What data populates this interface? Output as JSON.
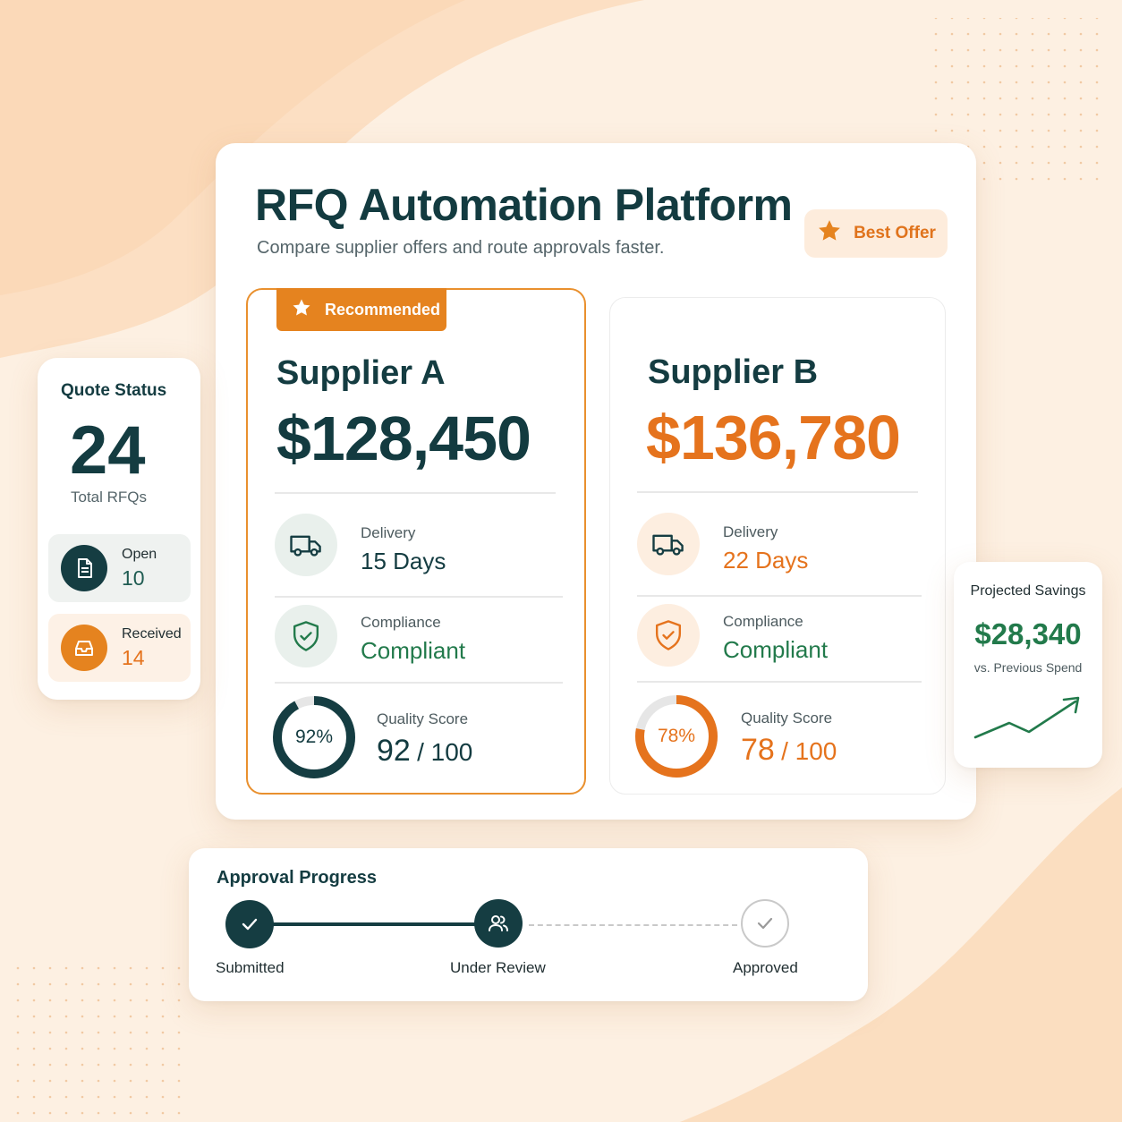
{
  "platform": {
    "title": "RFQ Automation Platform",
    "subtitle": "Compare supplier offers and route approvals faster.",
    "best_offer_label": "Best Offer"
  },
  "suppliers": [
    {
      "tag": "Recommended",
      "name": "Supplier A",
      "price": "$128,450",
      "delivery_label": "Delivery",
      "delivery_value": "15 Days",
      "compliance_label": "Compliance",
      "compliance_value": "Compliant",
      "quality_label": "Quality Score",
      "quality_percent_label": "92%",
      "quality_score": "92",
      "quality_max": "/ 100",
      "quality_fraction": 0.92,
      "accent_color": "#153d42"
    },
    {
      "name": "Supplier B",
      "price": "$136,780",
      "delivery_label": "Delivery",
      "delivery_value": "22 Days",
      "compliance_label": "Compliance",
      "compliance_value": "Compliant",
      "quality_label": "Quality Score",
      "quality_percent_label": "78%",
      "quality_score": "78",
      "quality_max": "/ 100",
      "quality_fraction": 0.78,
      "accent_color": "#e5731d"
    }
  ],
  "quote_status": {
    "title": "Quote Status",
    "total": "24",
    "total_label": "Total RFQs",
    "open_label": "Open",
    "open_count": "10",
    "received_label": "Received",
    "received_count": "14"
  },
  "savings": {
    "title": "Projected Savings",
    "value": "$28,340",
    "comparison": "vs. Previous Spend",
    "trend_icon": "trend-up-arrow"
  },
  "approval": {
    "title": "Approval Progress",
    "steps": [
      {
        "label": "Submitted",
        "status": "complete",
        "icon": "check-icon"
      },
      {
        "label": "Under Review",
        "status": "current",
        "icon": "users-icon"
      },
      {
        "label": "Approved",
        "status": "pending",
        "icon": "check-icon"
      }
    ]
  },
  "colors": {
    "brand_dark": "#153d42",
    "accent_orange": "#e5831f",
    "success_green": "#227a4b",
    "background": "#fdf0e2"
  }
}
